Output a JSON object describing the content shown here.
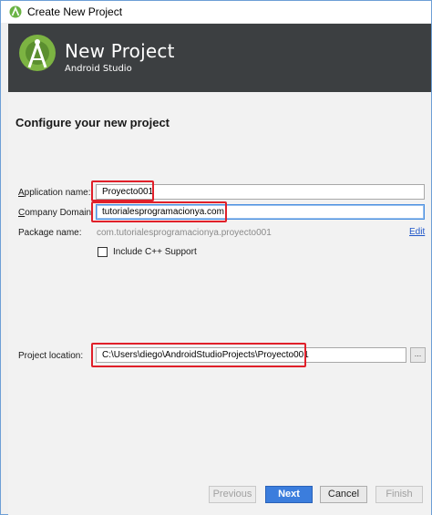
{
  "window": {
    "title": "Create New Project"
  },
  "header": {
    "title": "New Project",
    "subtitle": "Android Studio"
  },
  "section_title": "Configure your new project",
  "form": {
    "app_name": {
      "label_pre": "A",
      "label_rest": "pplication name:",
      "value": "Proyecto001"
    },
    "company_domain": {
      "label_pre": "C",
      "label_rest": "ompany Domain:",
      "value": "tutorialesprogramacionya.com"
    },
    "package_name": {
      "label": "Package name:",
      "value": "com.tutorialesprogramacionya.proyecto001",
      "edit_label": "Edit"
    },
    "include_cpp": {
      "label": "Include C++ Support",
      "checked": false
    },
    "project_location": {
      "label": "Project location:",
      "value": "C:\\Users\\diego\\AndroidStudioProjects\\Proyecto001",
      "browse_label": "..."
    }
  },
  "buttons": {
    "previous": "Previous",
    "next": "Next",
    "cancel": "Cancel",
    "finish": "Finish"
  },
  "colors": {
    "header_bg": "#3c3f41",
    "highlight": "#e0202a",
    "primary": "#3b7ddd",
    "android_green": "#a4c639"
  }
}
